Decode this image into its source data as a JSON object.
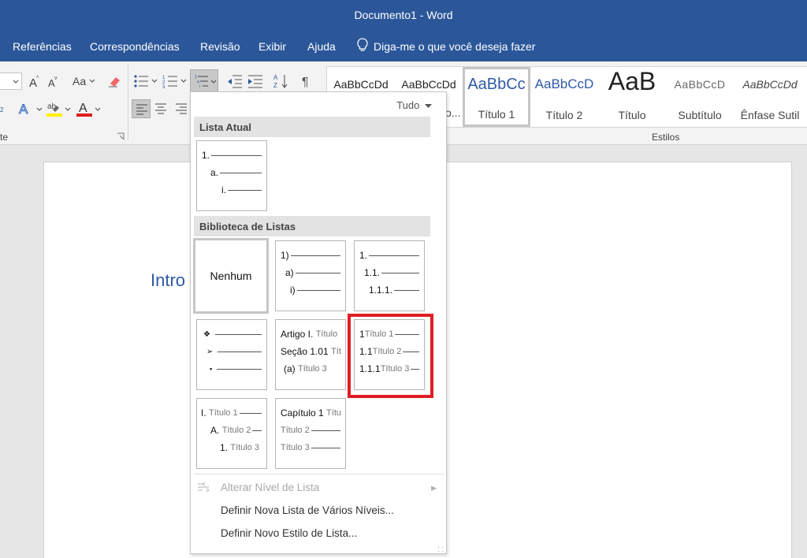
{
  "window": {
    "title": "Documento1  -  Word",
    "accent_color": "#2b579a"
  },
  "tabs": [
    {
      "label": "Referências"
    },
    {
      "label": "Correspondências"
    },
    {
      "label": "Revisão"
    },
    {
      "label": "Exibir"
    },
    {
      "label": "Ajuda"
    }
  ],
  "tellme": {
    "label": "Diga-me o que você deseja fazer",
    "icon": "lightbulb-icon"
  },
  "ribbon": {
    "font_group_label_partial": "te",
    "paragraph_group_tail": "",
    "styles_group_label": "Estilos",
    "change_case_label": "Aa",
    "styles": [
      {
        "sample": "AaBbCcDd",
        "name": ""
      },
      {
        "sample": "AaBbCcDd",
        "name": "o..."
      },
      {
        "sample": "AaBbCc",
        "name": "Título 1"
      },
      {
        "sample": "AaBbCcD",
        "name": "Título 2"
      },
      {
        "sample": "AaB",
        "name": "Título"
      },
      {
        "sample": "AaBbCcD",
        "name": "Subtítulo"
      },
      {
        "sample": "AaBbCcDd",
        "name": "Ênfase Sutil"
      }
    ]
  },
  "document": {
    "heading": "Intro"
  },
  "dropdown": {
    "filter_label": "Tudo",
    "current_list_header": "Lista Atual",
    "library_header": "Biblioteca de Listas",
    "current_tile": {
      "rows": [
        "1.",
        "a.",
        "i."
      ]
    },
    "library_tiles": [
      {
        "name": "Nenhum"
      },
      {
        "rows": [
          "1)",
          "a)",
          "i)"
        ]
      },
      {
        "rows": [
          "1.",
          "1.1.",
          "1.1.1."
        ]
      },
      {
        "rows": [
          "❖",
          "➢",
          "▪"
        ]
      },
      {
        "rows": [
          {
            "lbl": "Artigo I.",
            "sub": "Título"
          },
          {
            "lbl": "Seção 1.01",
            "sub": "Tít"
          },
          {
            "lbl": "(a)",
            "sub": "Título 3"
          }
        ]
      },
      {
        "rows": [
          {
            "lbl": "1",
            "sub": "Título 1"
          },
          {
            "lbl": "1.1",
            "sub": "Título 2"
          },
          {
            "lbl": "1.1.1",
            "sub": "Título 3"
          }
        ],
        "highlighted": true
      },
      {
        "rows": [
          {
            "lbl": "I.",
            "sub": "Título 1"
          },
          {
            "lbl": "A.",
            "sub": "Título 2"
          },
          {
            "lbl": "1.",
            "sub": "Título 3"
          }
        ]
      },
      {
        "rows": [
          {
            "lbl": "Capítulo 1",
            "sub": "Títu"
          },
          {
            "lbl": "",
            "sub": "Título 2"
          },
          {
            "lbl": "",
            "sub": "Título 3"
          }
        ]
      }
    ],
    "menu_items": [
      {
        "label": "Alterar Nível de Lista",
        "disabled": true
      },
      {
        "label": "Definir Nova Lista de Vários Níveis..."
      },
      {
        "label": "Definir Novo Estilo de Lista..."
      }
    ],
    "highlight_color": "#e01e24"
  }
}
